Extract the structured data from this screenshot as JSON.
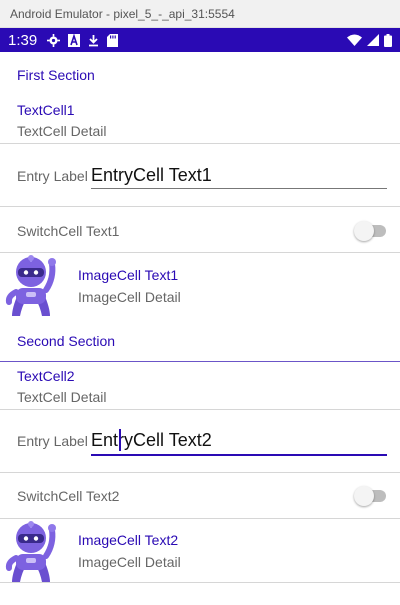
{
  "window": {
    "title": "Android Emulator - pixel_5_-_api_31:5554"
  },
  "status_bar": {
    "time": "1:39",
    "color": "#2a0ab4",
    "left_icons": [
      "gear-icon",
      "a-icon",
      "download-icon",
      "sd-card-icon"
    ],
    "right_icons": [
      "wifi-icon",
      "signal-icon",
      "battery-icon"
    ]
  },
  "sections": [
    {
      "header": "First Section",
      "text_cell": {
        "text": "TextCell1",
        "detail": "TextCell Detail"
      },
      "entry_cell": {
        "label": "Entry Label",
        "value": "EntryCell Text1",
        "focused": false
      },
      "switch_cell": {
        "text": "SwitchCell Text1",
        "on": false
      },
      "image_cell": {
        "image": "dotnet-bot-image",
        "text": "ImageCell Text1",
        "detail": "ImageCell Detail"
      }
    },
    {
      "header": "Second Section",
      "text_cell": {
        "text": "TextCell2",
        "detail": "TextCell Detail"
      },
      "entry_cell": {
        "label": "Entry Label",
        "value": "EntryCell Text2",
        "focused": true
      },
      "switch_cell": {
        "text": "SwitchCell Text2",
        "on": false
      },
      "image_cell": {
        "image": "dotnet-bot-image",
        "text": "ImageCell Text2",
        "detail": "ImageCell Detail"
      }
    }
  ],
  "colors": {
    "accent": "#2a0ab4",
    "detail_text": "#666666",
    "divider": "#d6d6d6"
  }
}
